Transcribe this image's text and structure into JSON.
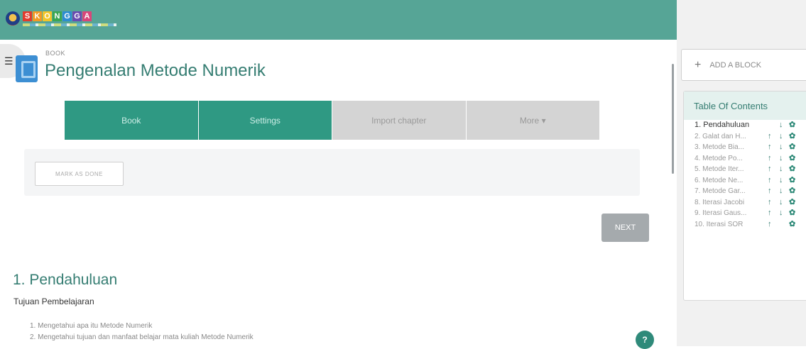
{
  "header": {
    "logo_letters": [
      "S",
      "K",
      "O",
      "N",
      "G",
      "G",
      "A"
    ]
  },
  "book": {
    "kicker": "BOOK",
    "title": "Pengenalan Metode Numerik"
  },
  "tabs": [
    {
      "label": "Book",
      "active": true
    },
    {
      "label": "Settings",
      "active": true
    },
    {
      "label": "Import chapter",
      "active": false
    },
    {
      "label": "More ▾",
      "active": false
    }
  ],
  "actions": {
    "mark_done": "MARK AS DONE",
    "next": "NEXT",
    "help": "?"
  },
  "chapter": {
    "title": "1. Pendahuluan",
    "subheading": "Tujuan Pembelajaran",
    "objectives": [
      "1. Mengetahui apa itu Metode Numerik",
      "2. Mengetahui tujuan dan manfaat belajar mata kuliah Metode Numerik"
    ]
  },
  "sidebar": {
    "add_block": "ADD A BLOCK",
    "toc_title": "Table Of Contents",
    "toc": [
      {
        "label": "1. Pendahuluan",
        "current": true,
        "up": false,
        "down": true
      },
      {
        "label": "2. Galat dan H...",
        "current": false,
        "up": true,
        "down": true
      },
      {
        "label": "3. Metode Bia...",
        "current": false,
        "up": true,
        "down": true
      },
      {
        "label": "4. Metode Po...",
        "current": false,
        "up": true,
        "down": true
      },
      {
        "label": "5. Metode Iter...",
        "current": false,
        "up": true,
        "down": true
      },
      {
        "label": "6. Metode Ne...",
        "current": false,
        "up": true,
        "down": true
      },
      {
        "label": "7. Metode Gar...",
        "current": false,
        "up": true,
        "down": true
      },
      {
        "label": "8. Iterasi Jacobi",
        "current": false,
        "up": true,
        "down": true
      },
      {
        "label": "9. Iterasi Gaus...",
        "current": false,
        "up": true,
        "down": true
      },
      {
        "label": "10. Iterasi SOR",
        "current": false,
        "up": true,
        "down": false
      }
    ]
  },
  "colors": {
    "header": "#56a596",
    "accent": "#357d72",
    "tab_active": "#2f9983",
    "tab_inactive": "#d4d4d4"
  }
}
